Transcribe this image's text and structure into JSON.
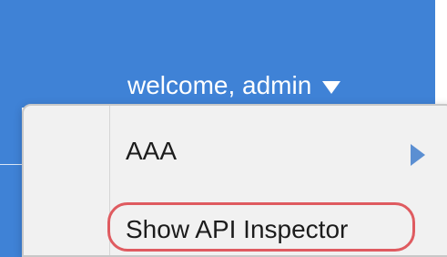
{
  "header": {
    "welcome_text": "welcome, admin"
  },
  "menu": {
    "items": [
      {
        "label": "AAA"
      },
      {
        "label": "Show API Inspector"
      }
    ]
  },
  "colors": {
    "header_blue": "#3f82d6",
    "menu_bg": "#f1f1f1",
    "highlight_red": "#df5b60",
    "submenu_arrow": "#5b8fd2"
  },
  "icons": {
    "dropdown_indicator": "chevron-down-icon",
    "submenu_indicator": "arrow-right-icon"
  }
}
